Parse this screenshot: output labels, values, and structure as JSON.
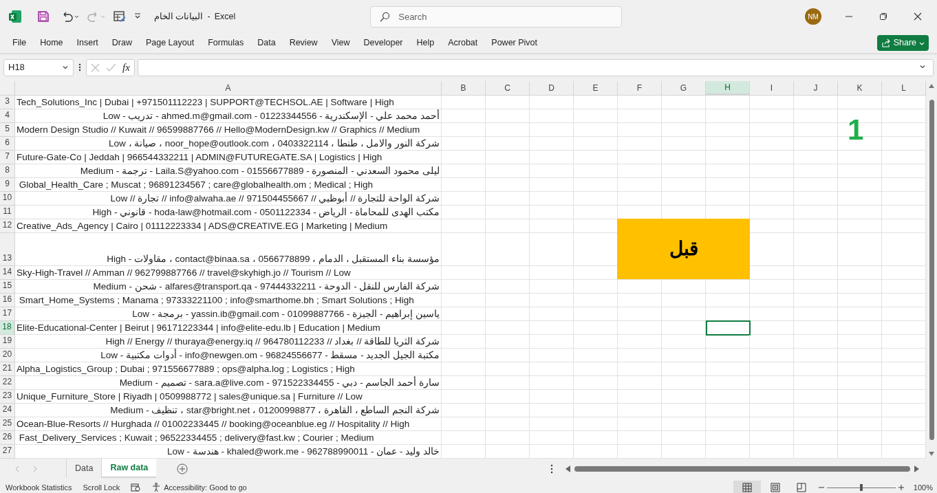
{
  "title_bar": {
    "file_name": "البيانات الخام",
    "separator": "-",
    "app": "Excel",
    "search_placeholder": "Search",
    "user_initials": "NM"
  },
  "ribbon_tabs": [
    {
      "label": "File"
    },
    {
      "label": "Home"
    },
    {
      "label": "Insert"
    },
    {
      "label": "Draw"
    },
    {
      "label": "Page Layout"
    },
    {
      "label": "Formulas"
    },
    {
      "label": "Data"
    },
    {
      "label": "Review"
    },
    {
      "label": "View"
    },
    {
      "label": "Developer"
    },
    {
      "label": "Help"
    },
    {
      "label": "Acrobat"
    },
    {
      "label": "Power Pivot"
    }
  ],
  "share_button": "Share",
  "formula_bar": {
    "name_box": "H18",
    "function_label": "fx"
  },
  "columns": [
    {
      "label": "A",
      "selected": false
    },
    {
      "label": "B",
      "selected": false
    },
    {
      "label": "C",
      "selected": false
    },
    {
      "label": "D",
      "selected": false
    },
    {
      "label": "E",
      "selected": false
    },
    {
      "label": "F",
      "selected": false
    },
    {
      "label": "G",
      "selected": false
    },
    {
      "label": "H",
      "selected": true
    },
    {
      "label": "I",
      "selected": false
    },
    {
      "label": "J",
      "selected": false
    },
    {
      "label": "K",
      "selected": false
    },
    {
      "label": "L",
      "selected": false
    }
  ],
  "rows": [
    {
      "number": "3",
      "kind": "ltr",
      "tall": false,
      "selected": false,
      "text": "Tech_Solutions_Inc | Dubai | +971501112223 | SUPPORT@TECHSOL.AE | Software | High"
    },
    {
      "number": "4",
      "kind": "rtl",
      "tall": false,
      "selected": false,
      "text": "أحمد محمد علي - الإسكندرية - 01223344556 - ahmed.m@gmail.com - تدريب - Low"
    },
    {
      "number": "5",
      "kind": "ltr",
      "tall": false,
      "selected": false,
      "text": "Modern Design Studio // Kuwait // 96599887766 // Hello@ModernDesign.kw // Graphics // Medium"
    },
    {
      "number": "6",
      "kind": "rtl",
      "tall": false,
      "selected": false,
      "text": "شركة النور والامل ، طنطا ، 0403322114 ، noor_hope@outlook.com ، صيانة ، Low"
    },
    {
      "number": "7",
      "kind": "ltr",
      "tall": false,
      "selected": false,
      "text": "Future-Gate-Co | Jeddah | 966544332211 | ADMIN@FUTUREGATE.SA | Logistics | High"
    },
    {
      "number": "8",
      "kind": "rtl",
      "tall": false,
      "selected": false,
      "text": "ليلى محمود السعدني - المنصورة - 01556677889 - Laila.S@yahoo.com - ترجمة - Medium"
    },
    {
      "number": "9",
      "kind": "ltr",
      "tall": false,
      "selected": false,
      "text": " Global_Health_Care ; Muscat ; 96891234567 ; care@globalhealth.om ; Medical ; High"
    },
    {
      "number": "10",
      "kind": "rtl",
      "tall": false,
      "selected": false,
      "text": "شركة الواحة للتجارة // أبوظبي // 971504455667 // info@alwaha.ae // تجارة // Low"
    },
    {
      "number": "11",
      "kind": "rtl",
      "tall": false,
      "selected": false,
      "text": "مكتب الهدى للمحاماة - الرياض - 0501122334 - hoda-law@hotmail.com - قانوني - High"
    },
    {
      "number": "12",
      "kind": "ltr",
      "tall": false,
      "selected": false,
      "text": "Creative_Ads_Agency | Cairo | 01112223334 | ADS@CREATIVE.EG | Marketing | Medium"
    },
    {
      "number": "13",
      "kind": "rtl",
      "tall": true,
      "selected": false,
      "text": "مؤسسة بناء المستقبل ، الدمام ، 0566778899 ، contact@binaa.sa ، مقاولات - High"
    },
    {
      "number": "14",
      "kind": "ltr",
      "tall": false,
      "selected": false,
      "text": "Sky-High-Travel // Amman // 962799887766 // travel@skyhigh.jo // Tourism // Low"
    },
    {
      "number": "15",
      "kind": "rtl",
      "tall": false,
      "selected": false,
      "text": "شركة الفارس للنقل - الدوحة - 97444332211 - alfares@transport.qa - شحن - Medium"
    },
    {
      "number": "16",
      "kind": "ltr",
      "tall": false,
      "selected": false,
      "text": " Smart_Home_Systems ; Manama ; 97333221100 ; info@smarthome.bh ; Smart Solutions ; High"
    },
    {
      "number": "17",
      "kind": "rtl",
      "tall": false,
      "selected": false,
      "text": "ياسين إبراهيم - الجيزة - 01099887766 - yassin.ib@gmail.com - برمجة - Low"
    },
    {
      "number": "18",
      "kind": "ltr",
      "tall": false,
      "selected": true,
      "text": "Elite-Educational-Center | Beirut | 96171223344 | info@elite-edu.lb | Education | Medium"
    },
    {
      "number": "19",
      "kind": "rtl",
      "tall": false,
      "selected": false,
      "text": "شركة الثريا للطاقة // بغداد // 964780112233 // High // Energy // thuraya@energy.iq"
    },
    {
      "number": "20",
      "kind": "rtl",
      "tall": false,
      "selected": false,
      "text": "مكتبة الجيل الجديد - مسقط - 96824556677 - info@newgen.om - أدوات مكتبية - Low"
    },
    {
      "number": "21",
      "kind": "ltr",
      "tall": false,
      "selected": false,
      "text": "Alpha_Logistics_Group ; Dubai ; 971556677889 ; ops@alpha.log ; Logistics ; High"
    },
    {
      "number": "22",
      "kind": "rtl",
      "tall": false,
      "selected": false,
      "text": "سارة أحمد الجاسم - دبي - 971522334455 - sara.a@live.com - تصميم - Medium"
    },
    {
      "number": "23",
      "kind": "ltr",
      "tall": false,
      "selected": false,
      "text": "Unique_Furniture_Store | Riyadh | 0509988772 | sales@unique.sa | Furniture // Low"
    },
    {
      "number": "24",
      "kind": "rtl",
      "tall": false,
      "selected": false,
      "text": "شركة النجم الساطع ، القاهرة ، 01200998877 ، star@bright.net ، تنظيف - Medium"
    },
    {
      "number": "25",
      "kind": "ltr",
      "tall": false,
      "selected": false,
      "text": "Ocean-Blue-Resorts // Hurghada // 01002233445 // booking@oceanblue.eg // Hospitality // High"
    },
    {
      "number": "26",
      "kind": "ltr",
      "tall": false,
      "selected": false,
      "text": " Fast_Delivery_Services ; Kuwait ; 96522334455 ; delivery@fast.kw ; Courier ; Medium"
    },
    {
      "number": "27",
      "kind": "rtl",
      "tall": false,
      "selected": false,
      "text": "خالد وليد - عمان - 962788990011 - khaled@work.me - هندسة - Low"
    }
  ],
  "shapes": [
    {
      "kind": "number",
      "text": "1"
    },
    {
      "kind": "box",
      "text": "قبل",
      "color": "#ffc000"
    }
  ],
  "sheet_tabs": [
    {
      "label": "Data",
      "selected": false
    },
    {
      "label": "Raw data",
      "selected": true
    }
  ],
  "status_bar": {
    "items": [
      "Workbook Statistics",
      "Scroll Lock"
    ],
    "accessibility": "Accessibility: Good to go",
    "zoom_slider": {
      "level": 0.5
    },
    "zoom": "100%"
  }
}
